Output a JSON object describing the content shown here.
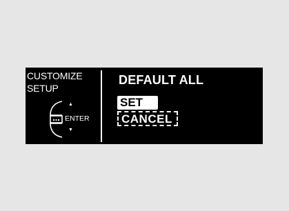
{
  "context": {
    "line1": "CUSTOMIZE",
    "line2": "SETUP"
  },
  "controls": {
    "enter_label": "ENTER",
    "up_arrow": "▲",
    "down_arrow": "▼",
    "dial_icon": "interface-dial-icon"
  },
  "main": {
    "title": "DEFAULT ALL",
    "options": [
      {
        "label": "SET",
        "selected": true
      },
      {
        "label": "CANCEL",
        "selected": false
      }
    ]
  },
  "colors": {
    "page_background": "#e6e6e6",
    "screen_background": "#000000",
    "foreground": "#ffffff"
  }
}
